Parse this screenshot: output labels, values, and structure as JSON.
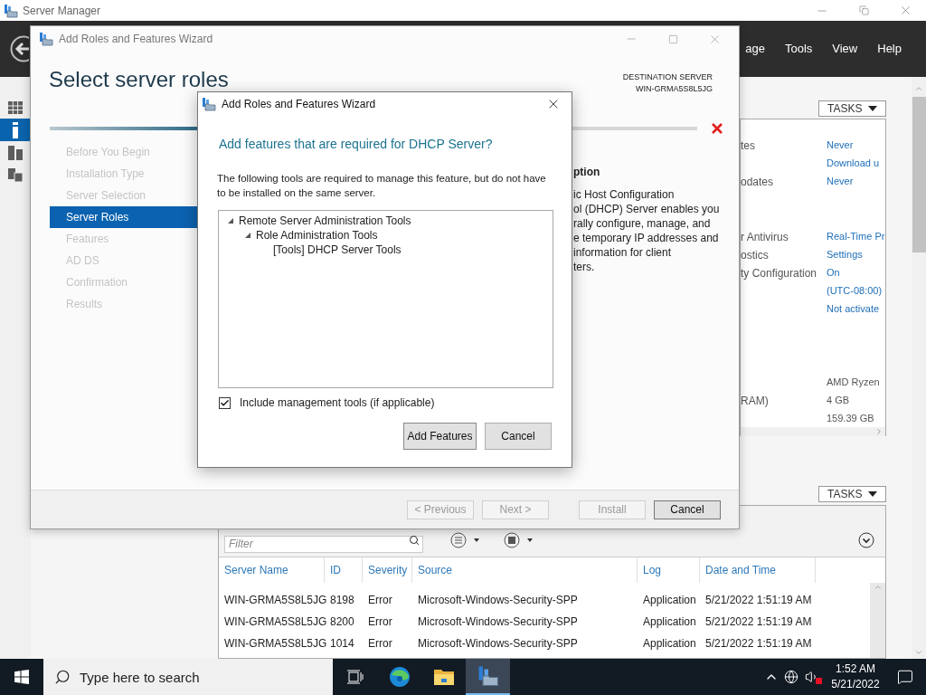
{
  "server_manager": {
    "title": "Server Manager",
    "menu": [
      "age",
      "Tools",
      "View",
      "Help"
    ],
    "nav": [
      {
        "selected": false
      },
      {
        "selected": true
      },
      {
        "selected": false
      },
      {
        "selected": false
      }
    ],
    "properties": {
      "tasks": "TASKS",
      "groups": [
        {
          "kind": "link",
          "rows": [
            {
              "label": "tes",
              "value": "Never"
            },
            {
              "value": "Download u"
            },
            {
              "label": "odates",
              "value": "Never"
            }
          ]
        },
        {
          "kind": "link",
          "rows": [
            {
              "label": "r Antivirus",
              "value": "Real-Time Pr"
            },
            {
              "label": "ostics",
              "value": "Settings"
            },
            {
              "label": "ty Configuration",
              "value": "On"
            },
            {
              "value": "(UTC-08:00)"
            },
            {
              "value": "Not activate"
            }
          ]
        },
        {
          "kind": "text",
          "rows": [
            {
              "value": "AMD Ryzen"
            },
            {
              "label": "RAM)",
              "value": "4 GB"
            },
            {
              "value": "159.39 GB"
            }
          ]
        }
      ]
    },
    "events": {
      "tasks": "TASKS",
      "filter_placeholder": "Filter",
      "columns": [
        "Server Name",
        "ID",
        "Severity",
        "Source",
        "Log",
        "Date and Time"
      ],
      "rows": [
        [
          "WIN-GRMA5S8L5JG",
          "8198",
          "Error",
          "Microsoft-Windows-Security-SPP",
          "Application",
          "5/21/2022 1:51:19 AM"
        ],
        [
          "WIN-GRMA5S8L5JG",
          "8200",
          "Error",
          "Microsoft-Windows-Security-SPP",
          "Application",
          "5/21/2022 1:51:19 AM"
        ],
        [
          "WIN-GRMA5S8L5JG",
          "1014",
          "Error",
          "Microsoft-Windows-Security-SPP",
          "Application",
          "5/21/2022 1:51:19 AM"
        ]
      ]
    }
  },
  "wizard": {
    "title": "Add Roles and Features Wizard",
    "heading": "Select server roles",
    "destination_label": "DESTINATION SERVER",
    "destination_server": "WIN-GRMA5S8L5JG",
    "steps": [
      {
        "label": "Before You Begin",
        "selected": false
      },
      {
        "label": "Installation Type",
        "selected": false
      },
      {
        "label": "Server Selection",
        "selected": false
      },
      {
        "label": "Server Roles",
        "selected": true
      },
      {
        "label": "Features",
        "selected": false
      },
      {
        "label": "AD DS",
        "selected": false
      },
      {
        "label": "Confirmation",
        "selected": false
      },
      {
        "label": "Results",
        "selected": false
      }
    ],
    "progress": {
      "level": 0.42
    },
    "description_heading": "ption",
    "description_lines": [
      "ic Host Configuration",
      "ol (DHCP) Server enables you",
      "rally configure, manage, and",
      "e temporary IP addresses and",
      "information for client",
      "ters."
    ],
    "buttons": [
      {
        "label": "< Previous",
        "disabled": true
      },
      {
        "label": "Next >",
        "disabled": true
      },
      {
        "label": "Install",
        "disabled": true
      },
      {
        "label": "Cancel",
        "disabled": false
      }
    ]
  },
  "dialog": {
    "title": "Add Roles and Features Wizard",
    "heading": "Add features that are required for DHCP Server?",
    "text": "The following tools are required to manage this feature, but do not have to be installed on the same server.",
    "tree": [
      {
        "label": "Remote Server Administration Tools",
        "expanded": true,
        "children": [
          {
            "label": "Role Administration Tools",
            "expanded": true,
            "children": [
              {
                "label": "[Tools] DHCP Server Tools"
              }
            ]
          }
        ]
      }
    ],
    "checkbox": {
      "label": "Include management tools (if applicable)",
      "checked": true
    },
    "buttons": [
      "Add Features",
      "Cancel"
    ]
  },
  "taskbar": {
    "search_placeholder": "Type here to search",
    "apps": [
      {
        "selected": false
      },
      {
        "selected": false
      },
      {
        "selected": false
      },
      {
        "selected": true
      }
    ],
    "time": "1:52 AM",
    "date": "5/21/2022"
  }
}
